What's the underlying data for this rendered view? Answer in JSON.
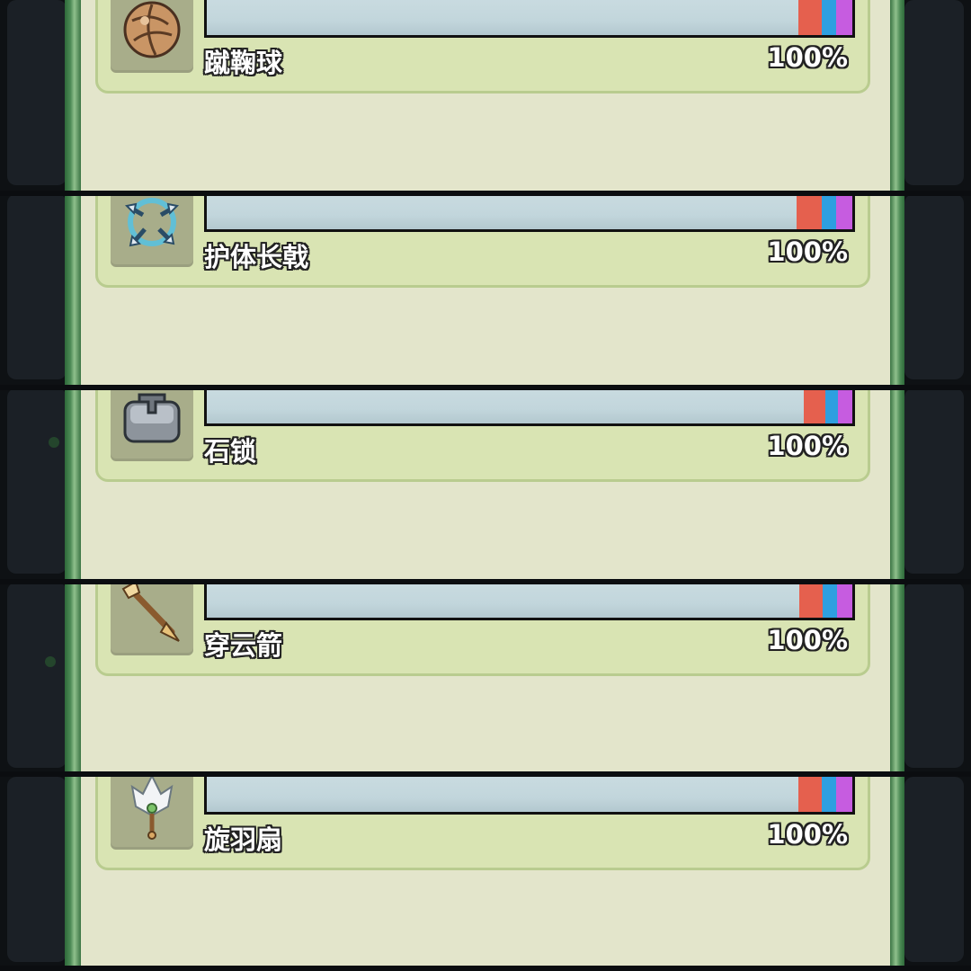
{
  "items": [
    {
      "name": "蹴鞠球",
      "percent": "100%",
      "icon": "leather-ball-icon",
      "progress": 1.0
    },
    {
      "name": "护体长戟",
      "percent": "100%",
      "icon": "spinning-halberd-icon",
      "progress": 1.0
    },
    {
      "name": "石锁",
      "percent": "100%",
      "icon": "stone-lock-icon",
      "progress": 1.0
    },
    {
      "name": "穿云箭",
      "percent": "100%",
      "icon": "arrow-icon",
      "progress": 1.0
    },
    {
      "name": "旋羽扇",
      "percent": "100%",
      "icon": "feather-fan-icon",
      "progress": 1.0
    }
  ],
  "colors": {
    "bar_fill": "#c4d8de",
    "seg_red": "#e5604e",
    "seg_blue": "#2e9fe0",
    "seg_purple": "#c65ce0",
    "card": "#d9e4b3",
    "panel": "#e3e5cb"
  }
}
